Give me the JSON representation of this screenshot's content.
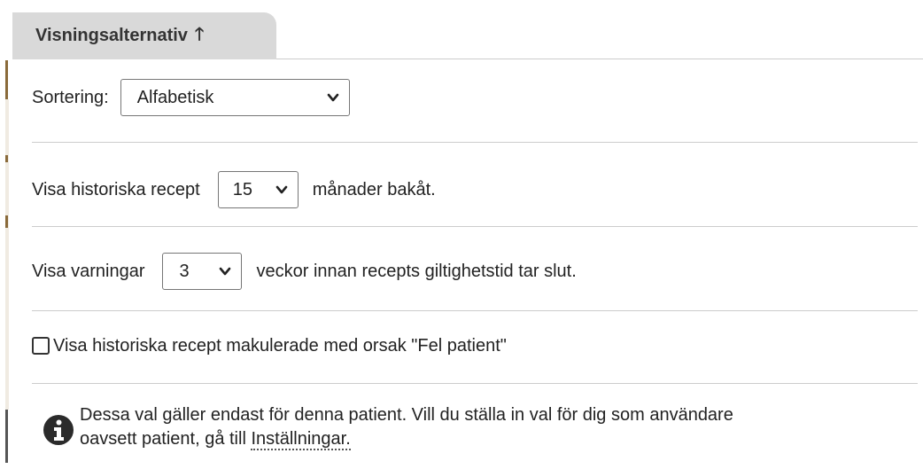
{
  "panel": {
    "tab_label": "Visningsalternativ"
  },
  "sorting": {
    "label": "Sortering:",
    "selected": "Alfabetisk"
  },
  "history": {
    "label_before": "Visa historiska recept",
    "selected": "15",
    "label_after": "månader bakåt."
  },
  "warnings": {
    "label_before": "Visa varningar",
    "selected": "3",
    "label_after": "veckor innan recepts giltighetstid tar slut."
  },
  "cancelled": {
    "label": "Visa historiska recept makulerade med orsak \"Fel patient\"",
    "checked": false
  },
  "info": {
    "text_line1": "Dessa val gäller endast för denna patient. Vill du ställa in val för dig som användare",
    "text_line2": "oavsett patient, gå till",
    "link_label": "Inställningar."
  }
}
